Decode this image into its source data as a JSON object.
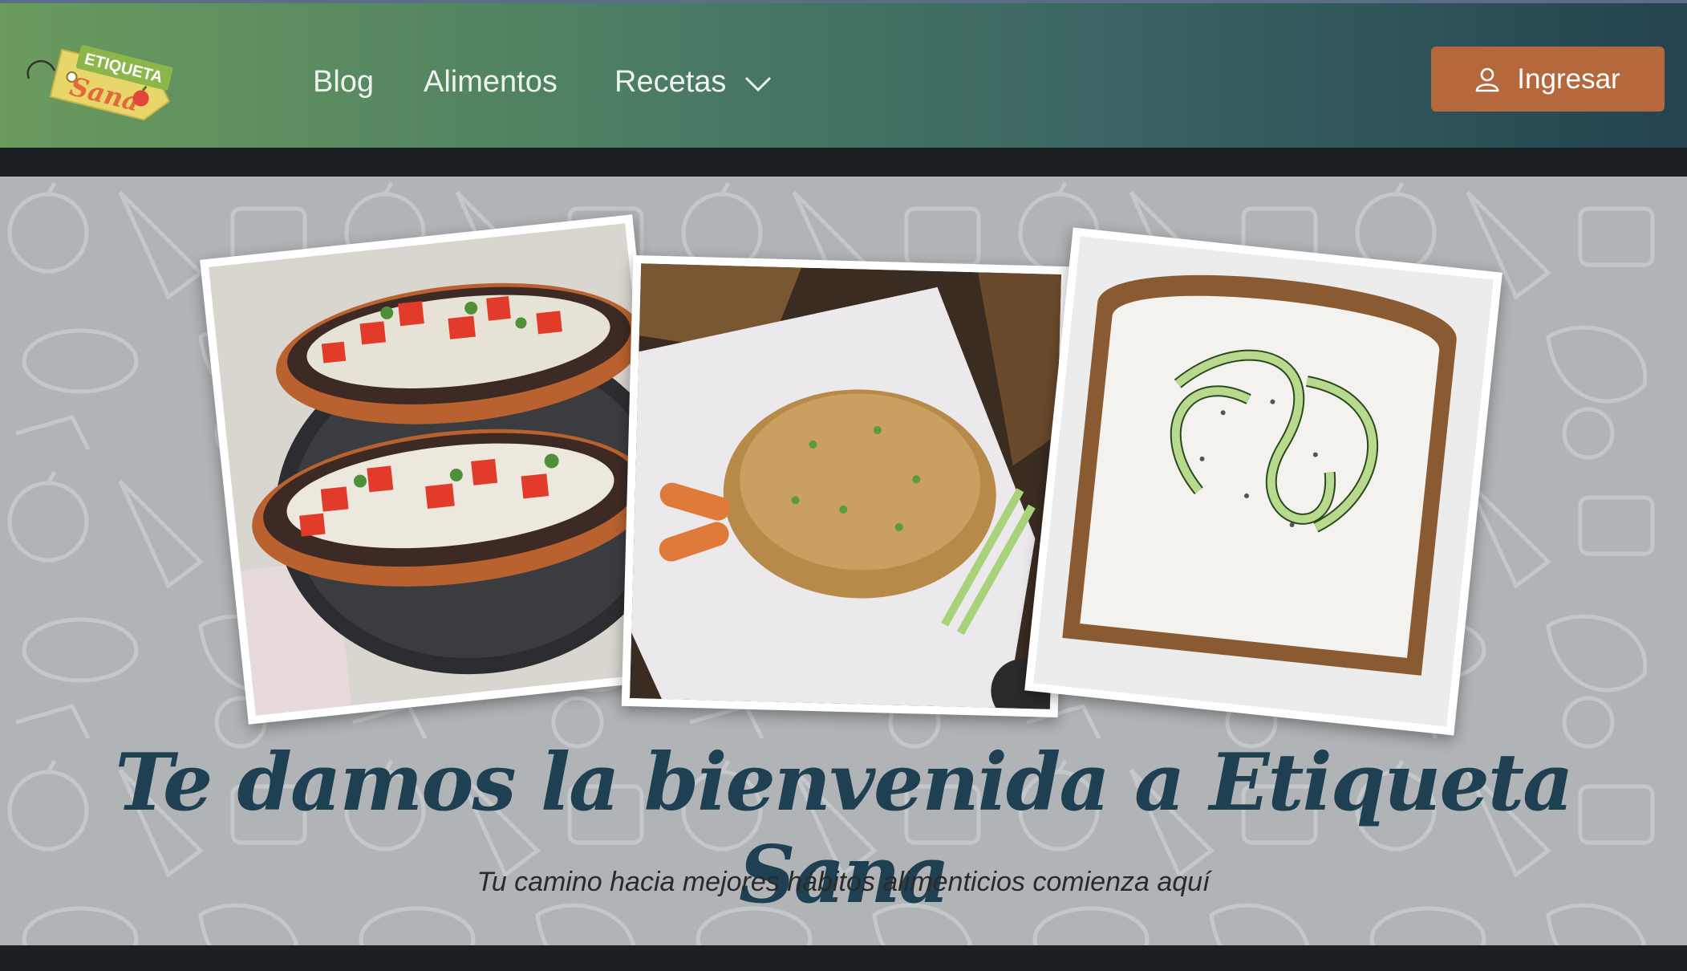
{
  "brand": {
    "logo_top": "ETIQUETA",
    "logo_bottom": "Sana"
  },
  "nav": {
    "items": [
      {
        "label": "Blog"
      },
      {
        "label": "Alimentos"
      },
      {
        "label": "Recetas"
      }
    ],
    "login_label": "Ingresar"
  },
  "hero": {
    "photos": [
      {
        "icon": "molletes-photo"
      },
      {
        "icon": "fried-rice-photo"
      },
      {
        "icon": "cucumber-toast-photo"
      }
    ],
    "title": "Te damos la bienvenida a Etiqueta Sana",
    "subtitle": "Tu camino hacia mejores hábitos alimenticios comienza aquí"
  },
  "colors": {
    "nav_gradient_start": "#6b9b5d",
    "nav_gradient_end": "#24434f",
    "login_button": "#b4683b",
    "title": "#1f4052",
    "hero_bg": "#b0b4b6"
  }
}
